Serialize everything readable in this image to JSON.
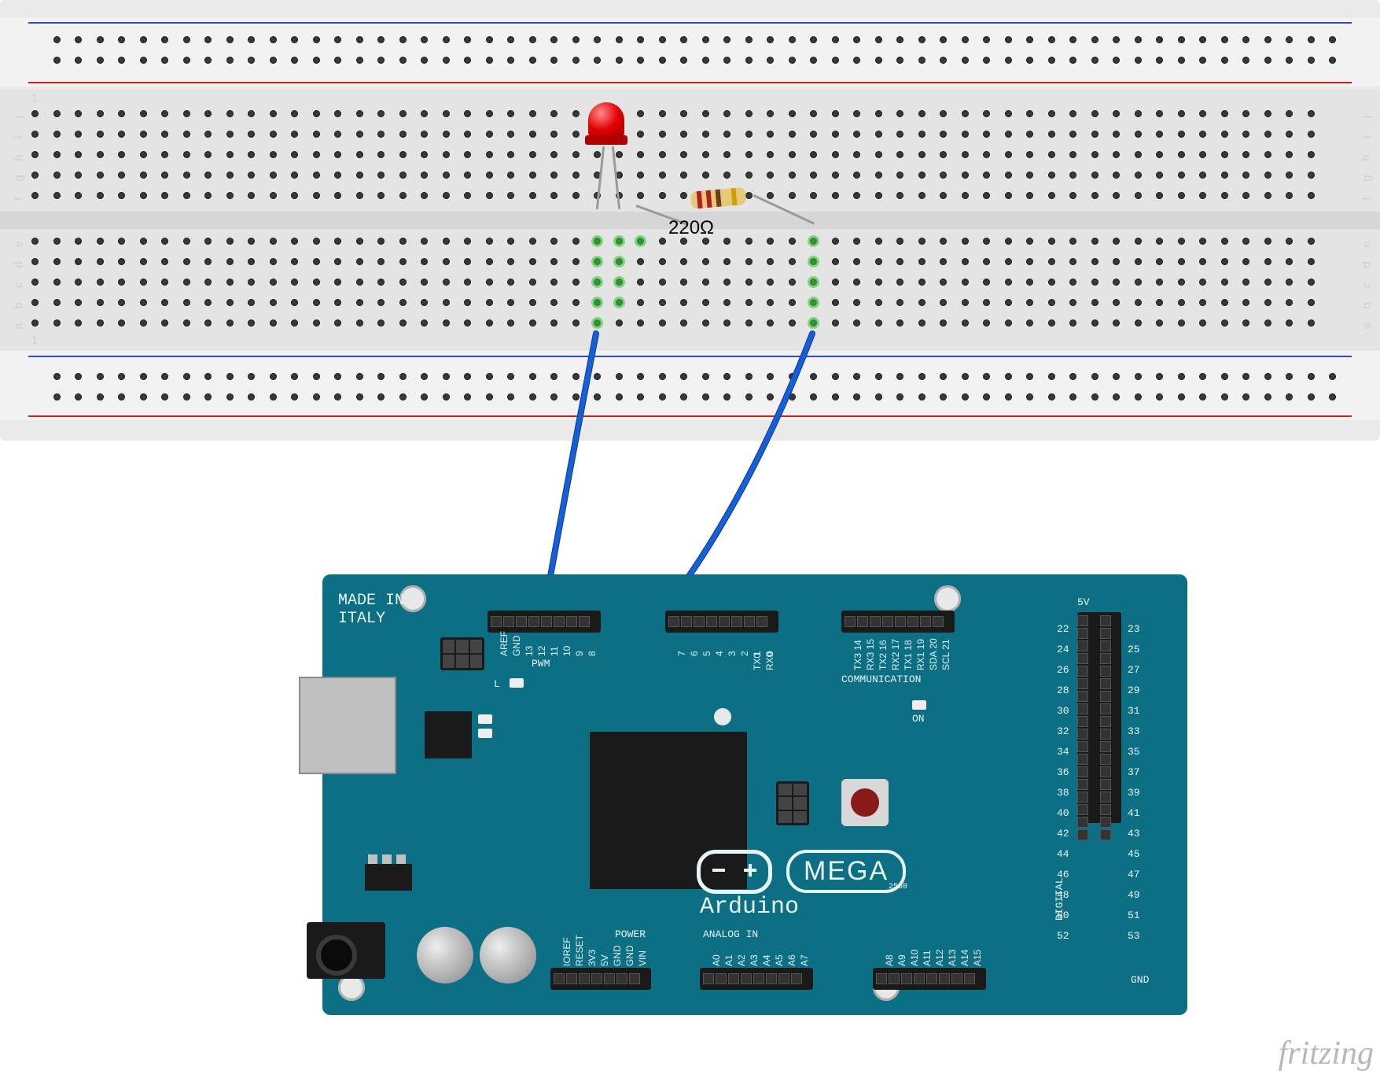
{
  "diagram": {
    "attribution": "fritzing",
    "components": {
      "breadboard": {
        "type": "full-size-breadboard",
        "columns": 60,
        "rows_top": [
          "j",
          "i",
          "h",
          "g",
          "f"
        ],
        "rows_bottom": [
          "e",
          "d",
          "c",
          "b",
          "a"
        ]
      },
      "arduino": {
        "model": "MEGA",
        "model_sub": "2560",
        "brand": "Arduino",
        "made_in": "MADE IN\nITALY",
        "labels": {
          "pwm": "PWM",
          "communication": "COMMUNICATION",
          "power": "POWER",
          "analog_in": "ANALOG IN",
          "digital": "DIGITAL",
          "l": "L",
          "tx": "TX",
          "rx": "RX",
          "on": "ON",
          "fivev": "5V",
          "gnd_r": "GND"
        },
        "top_pins_left": [
          "AREF",
          "GND",
          "13",
          "12",
          "11",
          "10",
          "9",
          "8"
        ],
        "top_pins_mid": [
          "7",
          "6",
          "5",
          "4",
          "3",
          "2",
          "1",
          "0"
        ],
        "top_comm_sub": [
          "TX0",
          "RX0"
        ],
        "top_pins_right": [
          "TX3 14",
          "RX3 15",
          "TX2 16",
          "RX2 17",
          "TX1 18",
          "RX1 19",
          "SDA 20",
          "SCL 21"
        ],
        "power_pins": [
          "IOREF",
          "RESET",
          "3V3",
          "5V",
          "GND",
          "GND",
          "VIN"
        ],
        "analog_pins_a": [
          "A0",
          "A1",
          "A2",
          "A3",
          "A4",
          "A5",
          "A6",
          "A7"
        ],
        "analog_pins_b": [
          "A8",
          "A9",
          "A10",
          "A11",
          "A12",
          "A13",
          "A14",
          "A15"
        ],
        "digital_right_left": [
          "22",
          "24",
          "26",
          "28",
          "30",
          "32",
          "34",
          "36",
          "38",
          "40",
          "42",
          "44",
          "46",
          "48",
          "50",
          "52"
        ],
        "digital_right_right": [
          "23",
          "25",
          "27",
          "29",
          "31",
          "33",
          "35",
          "37",
          "39",
          "41",
          "43",
          "45",
          "47",
          "49",
          "51",
          "53"
        ]
      },
      "led": {
        "color": "red",
        "anode_col": 27,
        "cathode_col": 28,
        "row": "f"
      },
      "resistor": {
        "value_ohms": 220,
        "label": "220Ω",
        "from": {
          "row": "f",
          "col": 29
        },
        "to": {
          "row": "f",
          "col": 37
        }
      }
    },
    "wires": [
      {
        "color": "blue",
        "from": {
          "board": "arduino",
          "pin": "GND"
        },
        "to": {
          "board": "breadboard",
          "row": "a",
          "col": 27
        }
      },
      {
        "color": "blue",
        "from": {
          "board": "arduino",
          "pin": "8"
        },
        "to": {
          "board": "breadboard",
          "row": "a",
          "col": 37
        }
      }
    ],
    "highlighted_holes": [
      {
        "row": "e",
        "col": 27
      },
      {
        "row": "d",
        "col": 27
      },
      {
        "row": "c",
        "col": 27
      },
      {
        "row": "b",
        "col": 27
      },
      {
        "row": "a",
        "col": 27
      },
      {
        "row": "e",
        "col": 28
      },
      {
        "row": "d",
        "col": 28
      },
      {
        "row": "c",
        "col": 28
      },
      {
        "row": "b",
        "col": 28
      },
      {
        "row": "e",
        "col": 29
      },
      {
        "row": "e",
        "col": 37
      },
      {
        "row": "d",
        "col": 37
      },
      {
        "row": "c",
        "col": 37
      },
      {
        "row": "b",
        "col": 37
      },
      {
        "row": "a",
        "col": 37
      }
    ]
  },
  "chart_data": {
    "type": "circuit-diagram",
    "nodes": [
      {
        "id": "ard_gnd",
        "part": "Arduino Mega 2560",
        "pin": "GND"
      },
      {
        "id": "ard_d8",
        "part": "Arduino Mega 2560",
        "pin": "D8"
      },
      {
        "id": "led",
        "part": "LED",
        "color": "red",
        "anode": "bb:f28",
        "cathode": "bb:f27"
      },
      {
        "id": "r1",
        "part": "Resistor",
        "ohms": 220,
        "a": "bb:f29",
        "b": "bb:f37"
      }
    ],
    "nets": [
      [
        "ard_gnd",
        "bb:a27",
        "bb:f27",
        "led.cathode"
      ],
      [
        "led.anode",
        "bb:f28",
        "bb:f29",
        "r1.a"
      ],
      [
        "r1.b",
        "bb:f37",
        "bb:a37",
        "ard_d8"
      ]
    ]
  }
}
